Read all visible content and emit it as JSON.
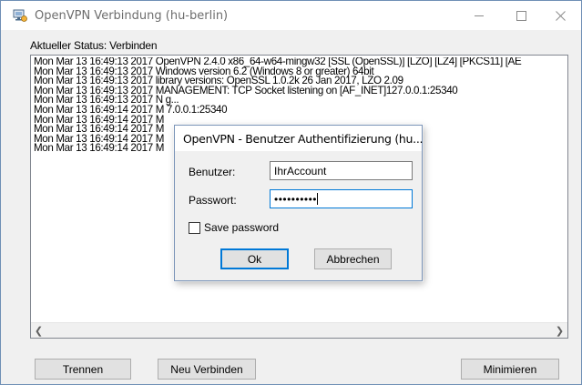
{
  "window": {
    "title": "OpenVPN Verbindung (hu-berlin)",
    "status": "Aktueller Status: Verbinden"
  },
  "log": {
    "lines": [
      "Mon Mar 13 16:49:13 2017 OpenVPN 2.4.0 x86_64-w64-mingw32 [SSL (OpenSSL)] [LZO] [LZ4] [PKCS11] [AE",
      "Mon Mar 13 16:49:13 2017 Windows version 6.2 (Windows 8 or greater) 64bit",
      "Mon Mar 13 16:49:13 2017 library versions: OpenSSL 1.0.2k  26 Jan 2017, LZO 2.09",
      "Mon Mar 13 16:49:13 2017 MANAGEMENT: TCP Socket listening on [AF_INET]127.0.0.1:25340",
      "Mon Mar 13 16:49:13 2017 N                                                                        g...",
      "Mon Mar 13 16:49:14 2017 M                                                                        7.0.0.1:25340",
      "Mon Mar 13 16:49:14 2017 M",
      "Mon Mar 13 16:49:14 2017 M",
      "Mon Mar 13 16:49:14 2017 M",
      "Mon Mar 13 16:49:14 2017 M"
    ]
  },
  "buttons": {
    "disconnect": "Trennen",
    "reconnect": "Neu Verbinden",
    "minimize": "Minimieren"
  },
  "dialog": {
    "title": "OpenVPN - Benutzer Authentifizierung (hu...",
    "username_label": "Benutzer:",
    "username_value": "IhrAccount",
    "password_label": "Passwort:",
    "password_masked": "••••••••••",
    "save_password_label": "Save password",
    "save_password_checked": false,
    "ok_label": "Ok",
    "cancel_label": "Abbrechen"
  },
  "colors": {
    "focus_blue": "#0078d7",
    "window_bg": "#f0f0f0"
  }
}
